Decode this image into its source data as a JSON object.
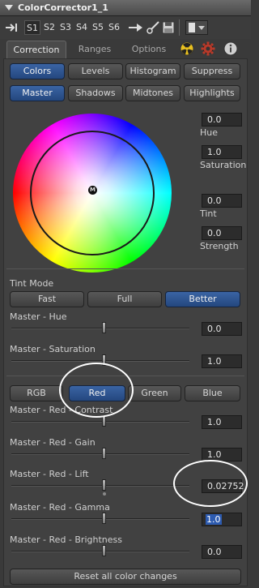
{
  "title": "ColorCorrector1_1",
  "toolbar": {
    "slots": [
      "S1",
      "S2",
      "S3",
      "S4",
      "S5",
      "S6"
    ]
  },
  "tabs": [
    "Correction",
    "Ranges",
    "Options"
  ],
  "mode_buttons": [
    "Colors",
    "Levels",
    "Histogram",
    "Suppress"
  ],
  "range_buttons": [
    "Master",
    "Shadows",
    "Midtones",
    "Highlights"
  ],
  "wheel": {
    "center_label": "M",
    "hue": {
      "label": "Hue",
      "value": "0.0"
    },
    "saturation": {
      "label": "Saturation",
      "value": "1.0"
    },
    "tint": {
      "label": "Tint",
      "value": "0.0"
    },
    "strength": {
      "label": "Strength",
      "value": "0.0"
    }
  },
  "tint_mode": {
    "label": "Tint Mode",
    "options": [
      "Fast",
      "Full",
      "Better"
    ],
    "selected": "Better"
  },
  "master_hue": {
    "label": "Master - Hue",
    "value": "0.0"
  },
  "master_saturation": {
    "label": "Master - Saturation",
    "value": "1.0"
  },
  "channels": [
    "RGB",
    "Red",
    "Green",
    "Blue"
  ],
  "channel_selected": "Red",
  "red_contrast": {
    "label": "Master - Red - Contrast",
    "value": "1.0"
  },
  "red_gain": {
    "label": "Master - Red - Gain",
    "value": "1.0"
  },
  "red_lift": {
    "label": "Master - Red - Lift",
    "value": "0.02752"
  },
  "red_gamma": {
    "label": "Master - Red - Gamma",
    "value": "1.0"
  },
  "red_brightness": {
    "label": "Master - Red - Brightness",
    "value": "0.0"
  },
  "reset_label": "Reset all color changes"
}
